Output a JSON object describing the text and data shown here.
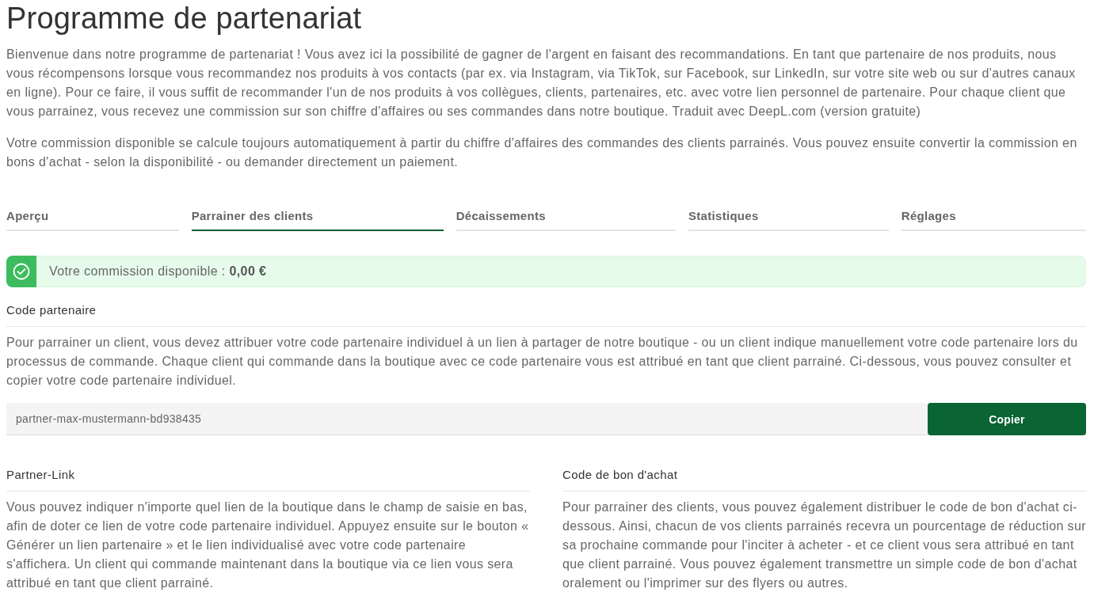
{
  "page": {
    "title": "Programme de partenariat",
    "intro": [
      "Bienvenue dans notre programme de partenariat ! Vous avez ici la possibilité de gagner de l'argent en faisant des recommandations. En tant que partenaire de nos produits, nous vous récompensons lorsque vous recommandez nos produits à vos contacts (par ex. via Instagram, via TikTok, sur Facebook, sur LinkedIn, sur votre site web ou sur d'autres canaux en ligne). Pour ce faire, il vous suffit de recommander l'un de nos produits à vos collègues, clients, partenaires, etc. avec votre lien personnel de partenaire. Pour chaque client que vous parrainez, vous recevez une commission sur son chiffre d'affaires ou ses commandes dans notre boutique. Traduit avec DeepL.com (version gratuite)",
      "Votre commission disponible se calcule toujours automatiquement à partir du chiffre d'affaires des commandes des clients parrainés. Vous pouvez ensuite convertir la commission en bons d'achat - selon la disponibilité - ou demander directement un paiement."
    ]
  },
  "tabs": [
    {
      "label": "Aperçu",
      "selected": false
    },
    {
      "label": "Parrainer des clients",
      "selected": true
    },
    {
      "label": "Décaissements",
      "selected": false
    },
    {
      "label": "Statistiques",
      "selected": false
    },
    {
      "label": "Réglages",
      "selected": false
    }
  ],
  "commission_alert": {
    "text": "Votre commission disponible : **0,00 €**"
  },
  "partner_code": {
    "heading": "Code partenaire",
    "text": "Pour parrainer un client, vous devez attribuer votre code partenaire individuel à un lien à partager de notre boutique - ou un client indique manuellement votre code partenaire lors du processus de commande. Chaque client qui commande dans la boutique avec ce code partenaire vous est attribué en tant que client parrainé. Ci-dessous, vous pouvez consulter et copier votre code partenaire individuel.",
    "code_field": {
      "value": "partner-max-mustermann-bd938435"
    },
    "copy_button": "Copier"
  },
  "partner_link": {
    "heading": "Partner-Link",
    "text": "Vous pouvez indiquer n'importe quel lien de la boutique dans le champ de saisie en bas, afin de doter ce lien de votre code partenaire individuel. Appuyez ensuite sur le bouton « Générer un lien partenaire » et le lien individualisé avec votre code partenaire s'affichera. Un client qui commande maintenant dans la boutique via ce lien vous sera attribué en tant que client parrainé."
  },
  "voucher_code": {
    "heading": "Code de bon d'achat",
    "text": "Pour parrainer des clients, vous pouvez également distribuer le code de bon d'achat ci-dessous. Ainsi, chacun de vos clients parrainés recevra un pourcentage de réduction sur sa prochaine commande pour l'inciter à acheter - et ce client vous sera attribué en tant que client parrainé. Vous pouvez également transmettre un simple code de bon d'achat oralement ou l'imprimer sur des flyers ou autres."
  }
}
